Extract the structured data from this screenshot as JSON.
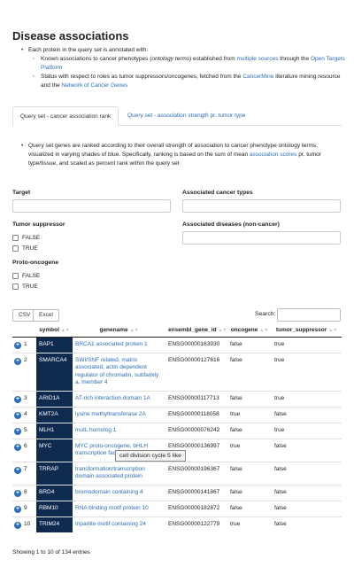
{
  "page": {
    "title": "Disease associations"
  },
  "intro": {
    "bullet": "Each protein in the query set is annotated with:",
    "sub1": {
      "pre": "Known associations to cancer phenotypes (",
      "italic": "ontology terms",
      "mid": ") established from ",
      "link1": "multiple sources",
      "mid2": " through the ",
      "link2": "Open Targets Platform"
    },
    "sub2": {
      "pre": "Status with respect to roles as tumor suppressors/oncogenes, fetched from the ",
      "link1": "CancerMine",
      "mid": " literature mining resource and the ",
      "link2": "Network of Cancer Genes"
    }
  },
  "tabs": {
    "active": "Query set - cancer association rank",
    "inactive": "Query set - association strength pr. tumor type"
  },
  "description": {
    "pre": "Query set genes are ranked according to their overall strength of association to cancer phenotype ontology terms, visualized in varying shades of blue. Specifically, ranking is based on the sum of mean ",
    "link": "association scores",
    "post": " pr. tumor type/tissue, and scaled as percent rank within the query set"
  },
  "filters": {
    "target_label": "Target",
    "cancer_types_label": "Associated cancer types",
    "tumor_suppressor_label": "Tumor suppressor",
    "diseases_label": "Associated diseases (non-cancer)",
    "proto_oncogene_label": "Proto-oncogene",
    "false_label": "FALSE",
    "true_label": "TRUE"
  },
  "toolbar": {
    "csv": "CSV",
    "excel": "Excel",
    "search_label": "Search:"
  },
  "table": {
    "headers": [
      "",
      "symbol",
      "genename",
      "ensembl_gene_id",
      "oncogene",
      "tumor_suppressor"
    ],
    "rows": [
      {
        "idx": "1",
        "symbol": "BAP1",
        "genename": "BRCA1 associated protein 1",
        "ensembl": "ENSG00000163930",
        "oncogene": "false",
        "tsg": "true"
      },
      {
        "idx": "2",
        "symbol": "SMARCA4",
        "genename": "SWI/SNF related, matrix associated, actin dependent regulator of chromatin, subfamily a, member 4",
        "ensembl": "ENSG00000127616",
        "oncogene": "false",
        "tsg": "true"
      },
      {
        "idx": "3",
        "symbol": "ARID1A",
        "genename": "AT-rich interaction domain 1A",
        "ensembl": "ENSG00000117713",
        "oncogene": "false",
        "tsg": "true"
      },
      {
        "idx": "4",
        "symbol": "KMT2A",
        "genename": "lysine methyltransferase 2A",
        "ensembl": "ENSG00000118058",
        "oncogene": "true",
        "tsg": "false"
      },
      {
        "idx": "5",
        "symbol": "MLH1",
        "genename": "mutL homolog 1",
        "ensembl": "ENSG00000076242",
        "oncogene": "false",
        "tsg": "true"
      },
      {
        "idx": "6",
        "symbol": "MYC",
        "genename": "MYC proto-oncogene, bHLH transcription factor",
        "ensembl": "ENSG00000136997",
        "oncogene": "true",
        "tsg": "false"
      },
      {
        "idx": "7",
        "symbol": "TRRAP",
        "genename": "transformation/transcription domain associated protein",
        "ensembl": "ENSG00000196367",
        "oncogene": "false",
        "tsg": "false"
      },
      {
        "idx": "8",
        "symbol": "BRD4",
        "genename": "bromodomain containing 4",
        "ensembl": "ENSG00000141867",
        "oncogene": "false",
        "tsg": "false"
      },
      {
        "idx": "9",
        "symbol": "RBM10",
        "genename": "RNA binding motif protein 10",
        "ensembl": "ENSG00000182872",
        "oncogene": "false",
        "tsg": "false"
      },
      {
        "idx": "10",
        "symbol": "TRIM24",
        "genename": "tripartite motif containing 24",
        "ensembl": "ENSG00000122779",
        "oncogene": "true",
        "tsg": "false"
      }
    ]
  },
  "tooltip": "cell division cycle 5 like",
  "footer": "Showing 1 to 10 of 134 entries",
  "colors": {
    "symbol_bg": "#0f2a4f",
    "link": "#2a6ebb",
    "expand_button": "#2a6ebb"
  }
}
